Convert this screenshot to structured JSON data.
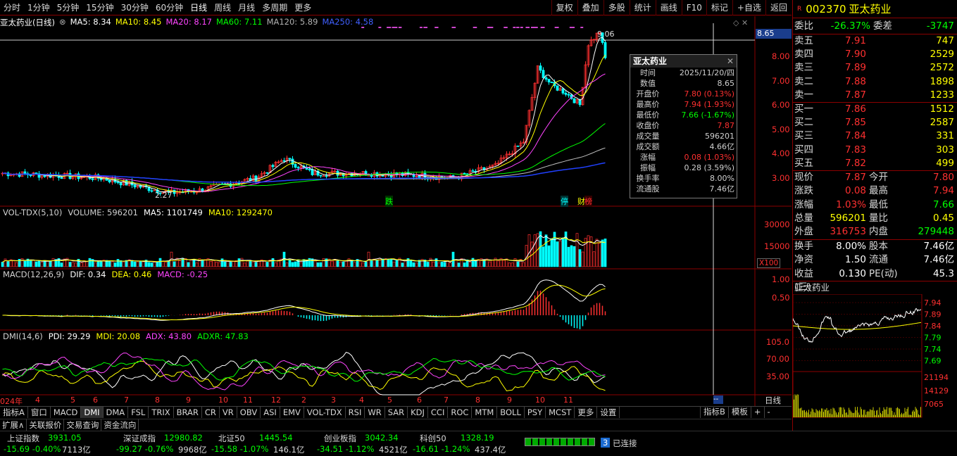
{
  "toolbar": {
    "periods": [
      "分时",
      "1分钟",
      "5分钟",
      "15分钟",
      "30分钟",
      "60分钟",
      "日线",
      "周线",
      "月线",
      "多周期",
      "更多"
    ],
    "active_period": "日线",
    "tools": [
      "复权",
      "叠加",
      "多股",
      "统计",
      "画线",
      "F10",
      "标记",
      "+自选",
      "返回"
    ]
  },
  "main_chart": {
    "stock_label": "亚太药业(日线)",
    "ma_labels": [
      {
        "text": "MA5: 8.34",
        "color": "#ffffff"
      },
      {
        "text": "MA10: 8.45",
        "color": "#ffff00"
      },
      {
        "text": "MA20: 8.17",
        "color": "#ff44ff"
      },
      {
        "text": "MA60: 7.11",
        "color": "#00ff00"
      },
      {
        "text": "MA120: 5.89",
        "color": "#b0b0b0"
      },
      {
        "text": "MA250: 4.58",
        "color": "#4060ff"
      }
    ],
    "y_ticks": [
      "8.00",
      "7.00",
      "6.00",
      "5.00",
      "4.00",
      "3.00"
    ],
    "current_price_tag": "8.65",
    "high_label": "9.06",
    "low_label": "2.27",
    "event_markers": [
      "跌",
      "停",
      "财",
      "榜"
    ]
  },
  "info_popup": {
    "title": "亚太药业",
    "rows": [
      {
        "k": "时间",
        "v": "2025/11/20/四",
        "c": "#d0d0d0"
      },
      {
        "k": "数值",
        "v": "8.65",
        "c": "#d0d0d0"
      },
      {
        "k": "开盘价",
        "v": "7.80 (0.13%)",
        "c": "#ff3030"
      },
      {
        "k": "最高价",
        "v": "7.94 (1.93%)",
        "c": "#ff3030"
      },
      {
        "k": "最低价",
        "v": "7.66 (-1.67%)",
        "c": "#00ff00"
      },
      {
        "k": "收盘价",
        "v": "7.87",
        "c": "#ff3030"
      },
      {
        "k": "成交量",
        "v": "596201",
        "c": "#d0d0d0"
      },
      {
        "k": "成交额",
        "v": "4.66亿",
        "c": "#d0d0d0"
      },
      {
        "k": "涨幅",
        "v": "0.08 (1.03%)",
        "c": "#ff3030"
      },
      {
        "k": "振幅",
        "v": "0.28 (3.59%)",
        "c": "#d0d0d0"
      },
      {
        "k": "换手率",
        "v": "8.00%",
        "c": "#d0d0d0"
      },
      {
        "k": "流通股",
        "v": "7.46亿",
        "c": "#d0d0d0"
      }
    ]
  },
  "volume_chart": {
    "labels": [
      {
        "text": "VOL-TDX(5,10)",
        "color": "#d0d0d0"
      },
      {
        "text": "VOLUME: 596201",
        "color": "#d0d0d0"
      },
      {
        "text": "MA5: 1101749",
        "color": "#ffffff"
      },
      {
        "text": "MA10: 1292470",
        "color": "#ffff00"
      }
    ],
    "y_ticks": [
      "30000",
      "15000"
    ],
    "unit": "X100"
  },
  "macd_chart": {
    "labels": [
      {
        "text": "MACD(12,26,9)",
        "color": "#d0d0d0"
      },
      {
        "text": "DIF: 0.34",
        "color": "#ffffff"
      },
      {
        "text": "DEA: 0.46",
        "color": "#ffff00"
      },
      {
        "text": "MACD: -0.25",
        "color": "#ff44ff"
      }
    ],
    "y_ticks": [
      "1.00",
      "0.50"
    ]
  },
  "dmi_chart": {
    "labels": [
      {
        "text": "DMI(14,6)",
        "color": "#d0d0d0"
      },
      {
        "text": "PDI: 29.29",
        "color": "#ffffff"
      },
      {
        "text": "MDI: 20.08",
        "color": "#ffff00"
      },
      {
        "text": "ADX: 43.80",
        "color": "#ff44ff"
      },
      {
        "text": "ADXR: 47.83",
        "color": "#00ff00"
      }
    ],
    "y_ticks": [
      "105.0",
      "70.00",
      "35.00"
    ],
    "period_label": "日线"
  },
  "x_axis": [
    "024年",
    "4",
    "5",
    "6",
    "7",
    "8",
    "9",
    "10",
    "11",
    "12",
    "2",
    "3",
    "4",
    "5",
    "6",
    "7",
    "8",
    "9",
    "10",
    "11"
  ],
  "indicator_tabs": [
    "指标A",
    "窗口",
    "MACD",
    "DMI",
    "DMA",
    "FSL",
    "TRIX",
    "BRAR",
    "CR",
    "VR",
    "OBV",
    "ASI",
    "EMV",
    "VOL-TDX",
    "RSI",
    "WR",
    "SAR",
    "KDJ",
    "CCI",
    "ROC",
    "MTM",
    "BOLL",
    "PSY",
    "MCST",
    "更多",
    "设置"
  ],
  "indicator_tabs_right": [
    "指标B",
    "模板",
    "+",
    "-"
  ],
  "bottom_tabs": [
    "扩展∧",
    "关联报价",
    "交易查询",
    "资金流向"
  ],
  "indices": [
    {
      "name": "上证指数",
      "value": "3931.05",
      "chg": "-15.69",
      "pct": "-0.40%",
      "amt": "7113亿"
    },
    {
      "name": "深证成指",
      "value": "12980.82",
      "chg": "-99.27",
      "pct": "-0.76%",
      "amt": "9968亿"
    },
    {
      "name": "北证50",
      "value": "1445.54",
      "chg": "-15.58",
      "pct": "-1.07%",
      "amt": "146.1亿"
    },
    {
      "name": "创业板指",
      "value": "3042.34",
      "chg": "-34.51",
      "pct": "-1.12%",
      "amt": "4521亿"
    },
    {
      "name": "科创50",
      "value": "1328.19",
      "chg": "-16.61",
      "pct": "-1.24%",
      "amt": "437.4亿"
    }
  ],
  "connection": {
    "count": "3",
    "text": "已连接"
  },
  "quote_panel": {
    "badge": "R",
    "code": "002370",
    "name": "亚太药业",
    "weibi_label": "委比",
    "weibi": "-26.37%",
    "weicha_label": "委差",
    "weicha": "-3747",
    "asks": [
      {
        "n": "卖五",
        "p": "7.91",
        "v": "747"
      },
      {
        "n": "卖四",
        "p": "7.90",
        "v": "2529"
      },
      {
        "n": "卖三",
        "p": "7.89",
        "v": "2572"
      },
      {
        "n": "卖二",
        "p": "7.88",
        "v": "1898"
      },
      {
        "n": "卖一",
        "p": "7.87",
        "v": "1233"
      }
    ],
    "bids": [
      {
        "n": "买一",
        "p": "7.86",
        "v": "1512"
      },
      {
        "n": "买二",
        "p": "7.85",
        "v": "2587"
      },
      {
        "n": "买三",
        "p": "7.84",
        "v": "331"
      },
      {
        "n": "买四",
        "p": "7.83",
        "v": "303"
      },
      {
        "n": "买五",
        "p": "7.82",
        "v": "499"
      }
    ],
    "stats": [
      {
        "k": "现价",
        "v": "7.87",
        "c1": "#ff3030",
        "k2": "今开",
        "v2": "7.80",
        "c2": "#ff3030"
      },
      {
        "k": "涨跌",
        "v": "0.08",
        "c1": "#ff3030",
        "k2": "最高",
        "v2": "7.94",
        "c2": "#ff3030"
      },
      {
        "k": "涨幅",
        "v": "1.03%",
        "c1": "#ff3030",
        "k2": "最低",
        "v2": "7.66",
        "c2": "#00ff00"
      },
      {
        "k": "总量",
        "v": "596201",
        "c1": "#ffff00",
        "k2": "量比",
        "v2": "0.45",
        "c2": "#ffff00"
      },
      {
        "k": "外盘",
        "v": "316753",
        "c1": "#ff3030",
        "k2": "内盘",
        "v2": "279448",
        "c2": "#00ff00"
      }
    ],
    "stats2": [
      {
        "k": "换手",
        "v": "8.00%",
        "k2": "股本",
        "v2": "7.46亿"
      },
      {
        "k": "净资",
        "v": "1.50",
        "k2": "流通",
        "v2": "7.46亿"
      },
      {
        "k": "收益(三)",
        "v": "0.130",
        "k2": "PE(动)",
        "v2": "45.3"
      }
    ],
    "mini_title": "亚太药业",
    "mini_prices": [
      "7.94",
      "7.89",
      "7.84",
      "7.79",
      "7.74",
      "7.69"
    ],
    "mini_vols": [
      "21194",
      "14129",
      "7065"
    ]
  },
  "colors": {
    "up": "#ff3030",
    "down": "#00ff00",
    "bg": "#000000",
    "border": "#8b0000"
  }
}
